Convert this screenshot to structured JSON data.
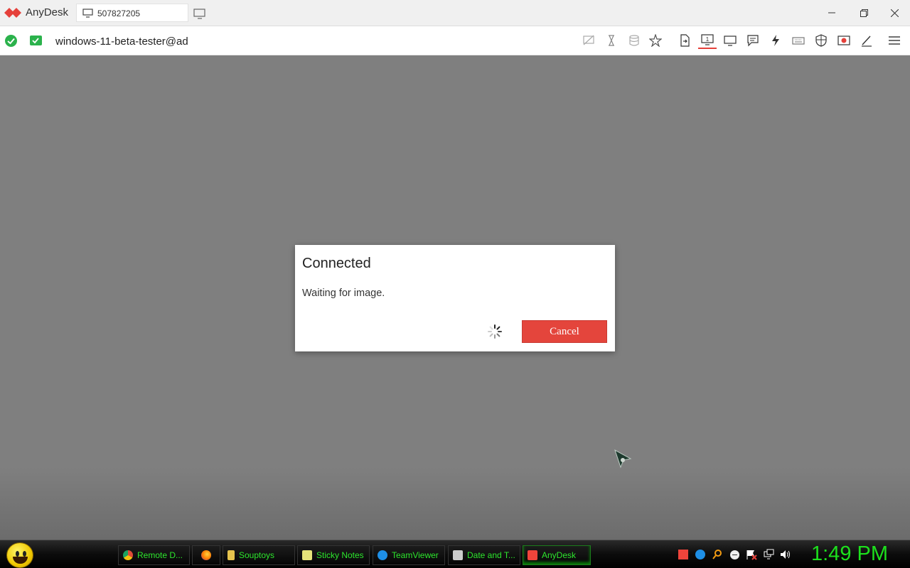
{
  "titlebar": {
    "app_name": "AnyDesk",
    "address": "507827205"
  },
  "toolbar": {
    "session_name": "windows-11-beta-tester@ad",
    "icons": [
      "display-off-icon",
      "hourglass-icon",
      "database-icon",
      "star-icon",
      "file-transfer-icon",
      "monitor-one-icon",
      "monitor-icon",
      "chat-icon",
      "lightning-icon",
      "keyboard-icon",
      "shield-icon",
      "record-icon",
      "pen-icon",
      "menu-icon"
    ]
  },
  "dialog": {
    "title": "Connected",
    "message": "Waiting for image.",
    "cancel_label": "Cancel"
  },
  "taskbar": {
    "tasks": [
      {
        "label": "Remote D...",
        "icon": "chrome-icon",
        "color": "#dd4b39"
      },
      {
        "label": "",
        "icon": "firefox-icon",
        "color": "#ff7a00"
      },
      {
        "label": "Souptoys",
        "icon": "souptoys-icon",
        "color": "#e6c34d"
      },
      {
        "label": "Sticky Notes",
        "icon": "sticky-notes-icon",
        "color": "#e6e37a"
      },
      {
        "label": "TeamViewer",
        "icon": "teamviewer-icon",
        "color": "#1e8fe6"
      },
      {
        "label": "Date and T...",
        "icon": "date-time-icon",
        "color": "#cccccc"
      },
      {
        "label": "AnyDesk",
        "icon": "anydesk-icon",
        "color": "#ef443b"
      }
    ],
    "clock": "1:49 PM"
  },
  "colors": {
    "accent": "#e4453c",
    "taskbar_text": "#2de62d",
    "clock": "#1de01d",
    "status_ok": "#2bb24c"
  }
}
